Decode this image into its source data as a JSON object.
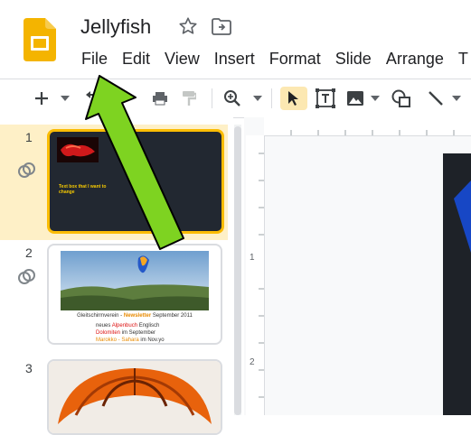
{
  "header": {
    "title": "Jellyfish",
    "logo_icon": "slides-logo-icon",
    "star_icon": "star-icon",
    "move_icon": "folder-move-icon"
  },
  "menu": [
    "File",
    "Edit",
    "View",
    "Insert",
    "Format",
    "Slide",
    "Arrange",
    "T"
  ],
  "toolbar": {
    "icons": [
      "add-icon",
      "chevron-down-icon",
      "undo-icon",
      "paint-format-icon",
      "zoom-icon",
      "select-icon",
      "text-box-icon",
      "image-icon",
      "shape-icon",
      "line-icon"
    ]
  },
  "slides": [
    {
      "number": "1",
      "selected": true,
      "caption": "Text box that I want to change"
    },
    {
      "number": "2",
      "selected": false,
      "line1_a": "Gleitschirmverein - ",
      "line1_b": "Newsletter",
      "line1_c": " September 2011",
      "line2_a": "neues ",
      "line2_b": "Alpenbuch",
      "line2_c": " Englisch",
      "line3_a": "Dolomiten",
      "line3_b": " im September",
      "line4_a": "Marokko - Sahara",
      "line4_b": " im Nov.yo"
    },
    {
      "number": "3",
      "selected": false
    }
  ],
  "ruler": {
    "left_marks": [
      "1",
      "2"
    ]
  },
  "annotation": {
    "arrow_color": "#7ed321"
  }
}
